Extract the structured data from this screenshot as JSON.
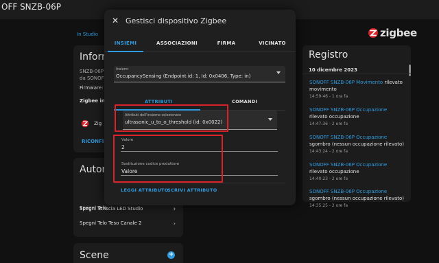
{
  "topbar": {
    "title": "OFF SNZB-06P"
  },
  "breadcrumb": {
    "link": "In Studio"
  },
  "brand": {
    "logo_text": "zigbee",
    "accent_color": "#2f9be0",
    "logo_color": "#d9232b",
    "highlight_color": "#d9232b"
  },
  "info_card": {
    "title": "Informa",
    "model": "SNZB-06P",
    "maker": "da SONOFF",
    "firmware": "Firmware: (",
    "zigbee_info": "Zigbee info",
    "zigbee_row": "Zig",
    "reconfigure": "RICONFI"
  },
  "automations_card": {
    "title": "Autom",
    "items": [
      "Spegni Telo",
      "Spegni Striscia LED Studio",
      "Spegni Telo Teso Canale 2"
    ]
  },
  "scenes_card": {
    "title": "Scene",
    "add_icon": "plus-icon"
  },
  "registry": {
    "title": "Registro",
    "date": "10 dicembre 2023",
    "entries": [
      {
        "device": "SONOFF SNZB-06P Movimento",
        "text": " rilevato movimento",
        "time": "14:59:46 - 1 ora fa"
      },
      {
        "device": "SONOFF SNZB-06P Occupazione",
        "text": " rilevato occupazione",
        "time": "14:47:36 - 2 ore fa"
      },
      {
        "device": "SONOFF SNZB-06P Occupazione",
        "text": " sgombro (nessun occupazione rilevato)",
        "time": "14:43:24 - 2 ore fa"
      },
      {
        "device": "SONOFF SNZB-06P Occupazione",
        "text": " rilevato occupazione",
        "time": "14:40:23 - 2 ore fa"
      },
      {
        "device": "SONOFF SNZB-06P Occupazione",
        "text": " sgombro (nessun occupazione rilevato)",
        "time": "14:35:25 - 2 ore fa"
      }
    ]
  },
  "dialog": {
    "title": "Gestisci dispositivo Zigbee",
    "close_icon": "close-icon",
    "tabs": [
      "INSIEMI",
      "ASSOCIAZIONI",
      "FIRMA",
      "VICINATO"
    ],
    "active_tab": "INSIEMI",
    "cluster_select": {
      "label": "Insiemi",
      "value": "OccupancySensing (Endpoint id: 1, Id: 0x0406, Type: in)"
    },
    "subtabs": [
      "ATTRIBUTI",
      "COMANDI"
    ],
    "active_subtab": "ATTRIBUTI",
    "attribute_select": {
      "label": "Attributi dell'insieme selezionato",
      "value": "ultrasonic_u_to_o_threshold (id: 0x0022)"
    },
    "value_field": {
      "label": "Valore",
      "value": "2"
    },
    "manufacturer_field": {
      "label": "Sostituzione codice produttore",
      "value": "Valore"
    },
    "actions": {
      "read": "LEGGI ATTRIBUTO",
      "write": "SCRIVI ATTRIBUTO"
    }
  }
}
